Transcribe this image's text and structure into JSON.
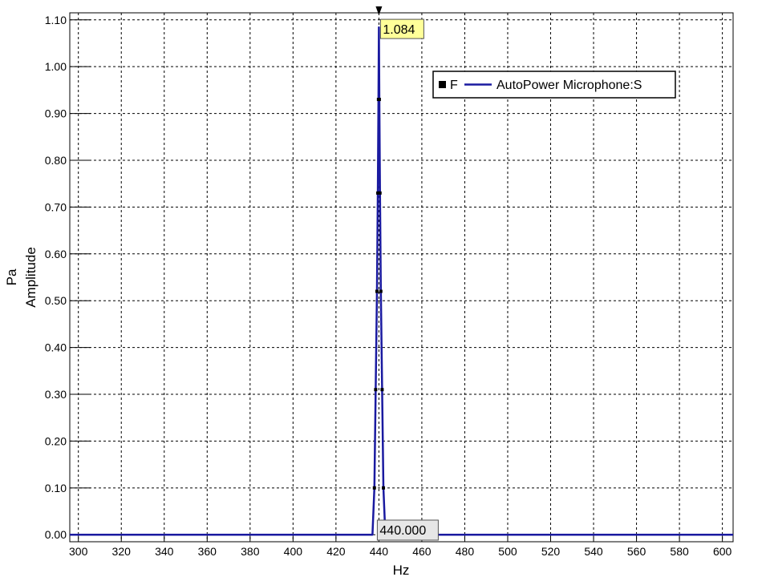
{
  "chart_data": {
    "type": "line",
    "xlabel": "Hz",
    "ylabel_unit": "Pa",
    "ylabel": "Amplitude",
    "xlim": [
      296,
      605
    ],
    "ylim": [
      -0.015,
      1.115
    ],
    "xticks": [
      300,
      320,
      340,
      360,
      380,
      400,
      420,
      440,
      460,
      480,
      500,
      520,
      540,
      560,
      580,
      600
    ],
    "yticks": [
      0.0,
      0.1,
      0.2,
      0.3,
      0.4,
      0.5,
      0.6,
      0.7,
      0.8,
      0.9,
      1.0,
      1.1
    ],
    "grid": true,
    "legend": {
      "placement": "top-right",
      "marker_label": "F",
      "series_label": "AutoPower Microphone:S"
    },
    "series": [
      {
        "name": "AutoPower Microphone:S",
        "color": "#1a1aa0",
        "x": [
          296,
          437,
          437.9,
          438.5,
          439.1,
          439.5,
          439.8,
          440.0,
          440.2,
          440.5,
          440.9,
          441.5,
          442.1,
          443,
          605
        ],
        "y": [
          0.0,
          0.0,
          0.1,
          0.31,
          0.52,
          0.73,
          0.93,
          1.084,
          0.93,
          0.73,
          0.52,
          0.31,
          0.1,
          0.0,
          0.0
        ]
      }
    ],
    "cursors": {
      "peak_value_label": "1.084",
      "peak_frequency_label": "440.000",
      "peak_x": 440.0,
      "peak_y": 1.084
    }
  }
}
